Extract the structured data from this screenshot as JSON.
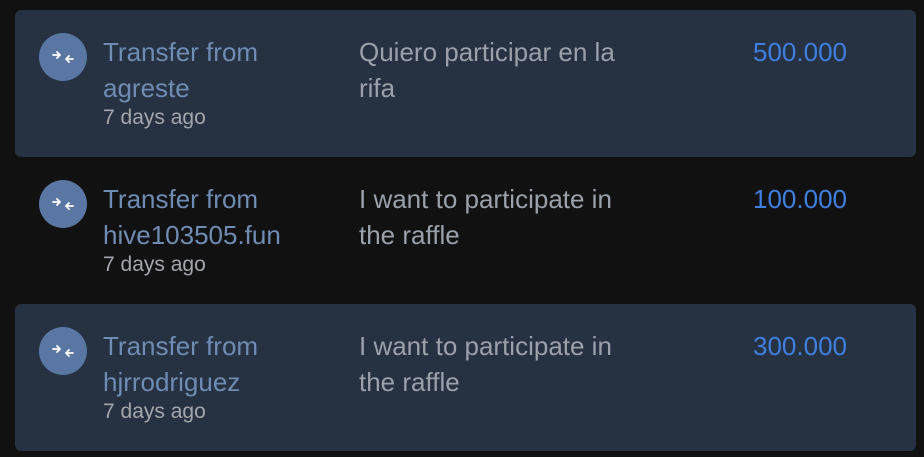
{
  "transfers": [
    {
      "title": "Transfer from agreste",
      "time": "7 days ago",
      "memo": "Quiero participar en la rifa",
      "amount": "500.000",
      "icon": "transfer-arrows-icon"
    },
    {
      "title": "Transfer from hive103505.fun",
      "time": "7 days ago",
      "memo": "I want to participate in the raffle",
      "amount": "100.000",
      "icon": "transfer-arrows-icon"
    },
    {
      "title": "Transfer from hjrrodriguez",
      "time": "7 days ago",
      "memo": "I want to participate in the raffle",
      "amount": "300.000",
      "icon": "transfer-arrows-icon"
    }
  ],
  "colors": {
    "page_background": "#121112",
    "row_shaded_background": "#263141",
    "avatar_background": "#5a77a4",
    "title_color": "#6f8cb4",
    "memo_color": "#9aa1ab",
    "time_color": "#a3a7ad",
    "amount_color": "#3e7fe0"
  }
}
